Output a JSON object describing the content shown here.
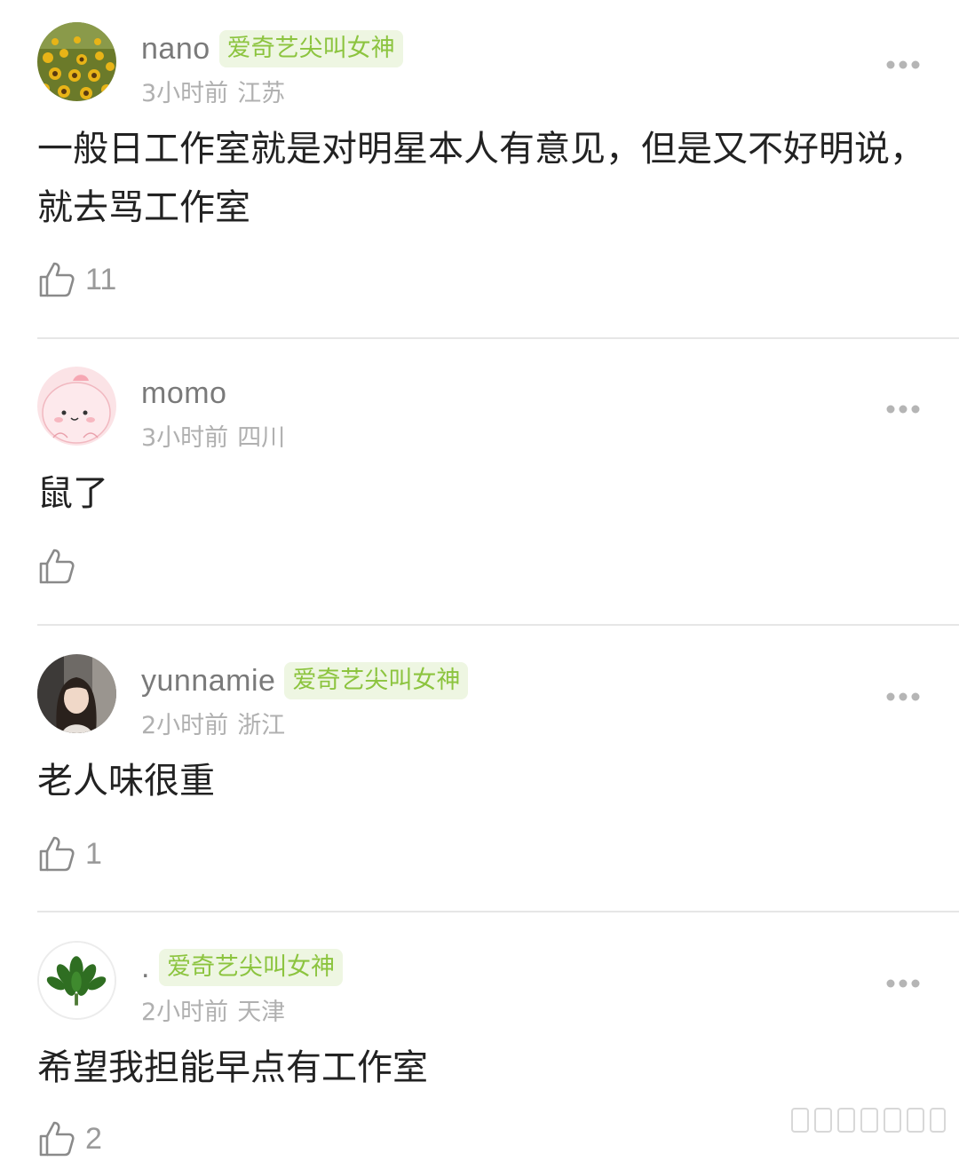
{
  "comments": [
    {
      "username": "nano",
      "badge": "爱奇艺尖叫女神",
      "time": "3小时前",
      "location": "江苏",
      "text": "一般日工作室就是对明星本人有意见，但是又不好明说，就去骂工作室",
      "likes": "11",
      "avatar": "sunflower-field"
    },
    {
      "username": "momo",
      "badge": "",
      "time": "3小时前",
      "location": "四川",
      "text": "鼠了",
      "likes": "",
      "avatar": "pink-cartoon"
    },
    {
      "username": "yunnamie",
      "badge": "爱奇艺尖叫女神",
      "time": "2小时前",
      "location": "浙江",
      "text": "老人味很重",
      "likes": "1",
      "avatar": "woman-photo"
    },
    {
      "username": ".",
      "badge": "爱奇艺尖叫女神",
      "time": "2小时前",
      "location": "天津",
      "text": "希望我担能早点有工作室",
      "likes": "2",
      "avatar": "green-leaves"
    }
  ],
  "icons": {
    "like": "thumbs-up-outline-icon",
    "more": "more-dots-icon"
  },
  "colors": {
    "badge_text": "#8cc43f",
    "badge_bg": "#eef6e2",
    "username": "#7a7a7a",
    "meta": "#b0b0b0",
    "body_text": "#222222",
    "divider": "#e6e6e6"
  }
}
